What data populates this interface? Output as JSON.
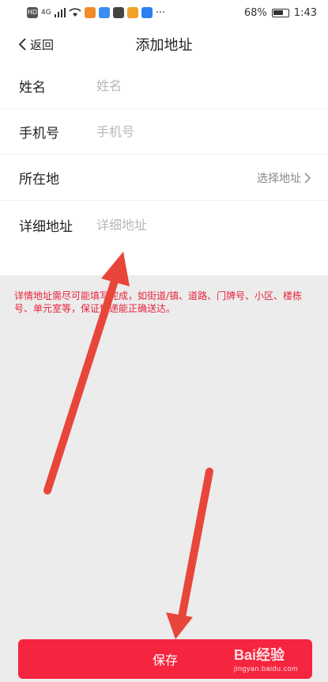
{
  "status_bar": {
    "signal_text": "4G",
    "more": "···",
    "battery_percent": "68%",
    "time": "1:43"
  },
  "nav": {
    "back_label": "返回",
    "title": "添加地址"
  },
  "form": {
    "name": {
      "label": "姓名",
      "placeholder": "姓名"
    },
    "phone": {
      "label": "手机号",
      "placeholder": "手机号"
    },
    "location": {
      "label": "所在地",
      "select_label": "选择地址"
    },
    "detail": {
      "label": "详细地址",
      "placeholder": "详细地址"
    }
  },
  "tip_text": "详情地址需尽可能填写完成，如街道/镇、道路、门牌号、小区、楼栋号、单元室等，保证快递能正确送达。",
  "save_label": "保存",
  "watermark": {
    "brand": "Bai经验",
    "url": "jingyan.baidu.com"
  },
  "colors": {
    "accent": "#f5253f",
    "tip": "#e8233a",
    "annotation_arrow": "#e8463a"
  }
}
